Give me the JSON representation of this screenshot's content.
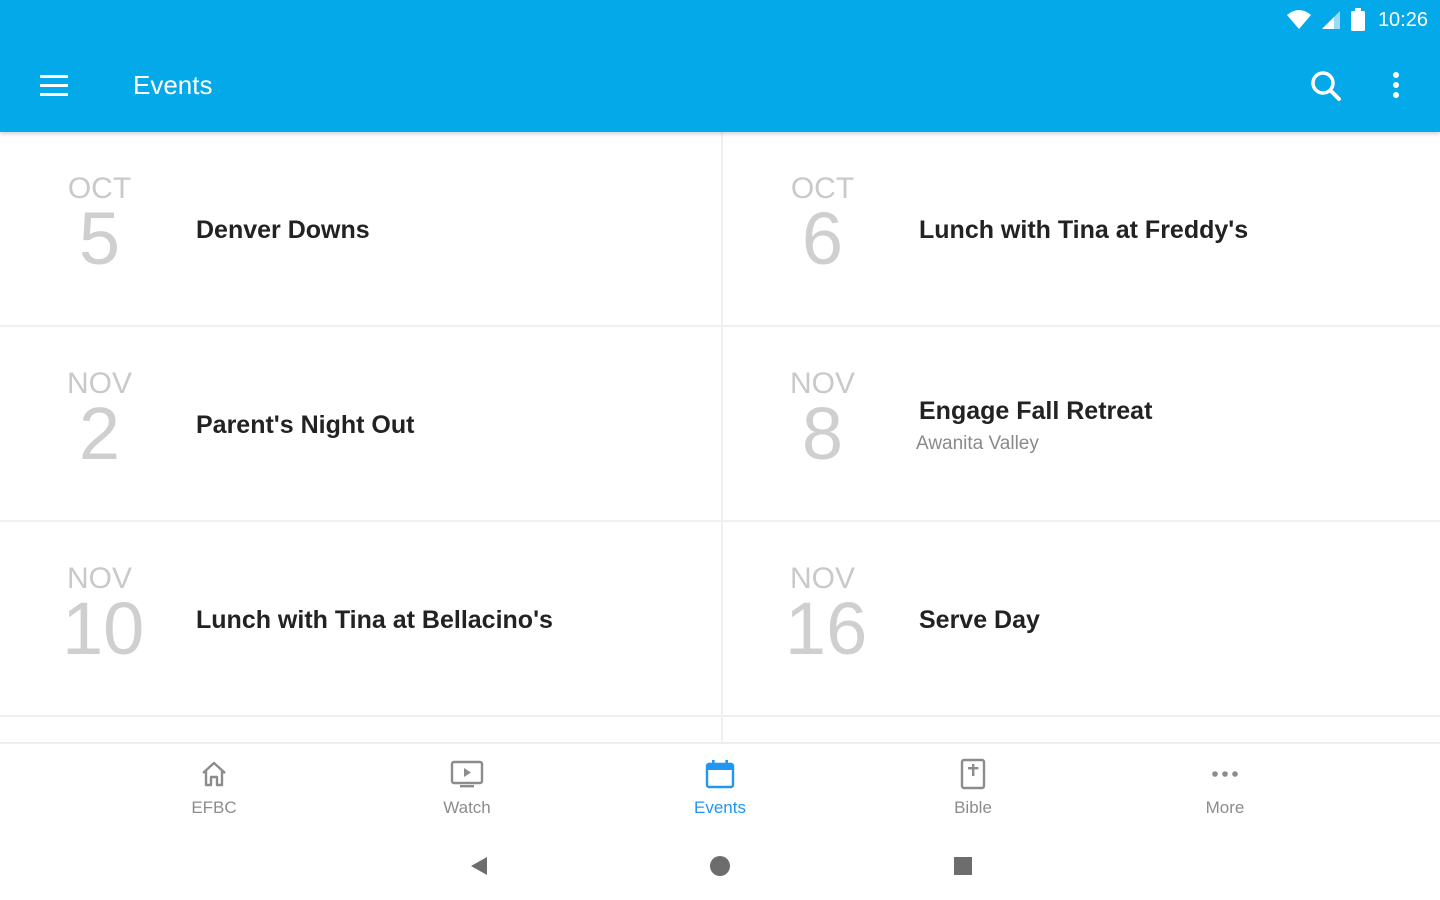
{
  "status_bar": {
    "time": "10:26"
  },
  "toolbar": {
    "title": "Events"
  },
  "events": [
    {
      "month": "OCT",
      "day": "5",
      "title": "Denver Downs",
      "subtitle": ""
    },
    {
      "month": "OCT",
      "day": "6",
      "title": "Lunch with Tina at Freddy's",
      "subtitle": ""
    },
    {
      "month": "NOV",
      "day": "2",
      "title": "Parent's Night Out",
      "subtitle": ""
    },
    {
      "month": "NOV",
      "day": "8",
      "title": "Engage Fall Retreat",
      "subtitle": "Awanita Valley"
    },
    {
      "month": "NOV",
      "day": "10",
      "title": "Lunch with Tina at Bellacino's",
      "subtitle": ""
    },
    {
      "month": "NOV",
      "day": "16",
      "title": "Serve Day",
      "subtitle": ""
    }
  ],
  "bottom_nav": [
    {
      "label": "EFBC",
      "icon": "home-icon",
      "active": false
    },
    {
      "label": "Watch",
      "icon": "tv-play-icon",
      "active": false
    },
    {
      "label": "Events",
      "icon": "calendar-icon",
      "active": true
    },
    {
      "label": "Bible",
      "icon": "bible-icon",
      "active": false
    },
    {
      "label": "More",
      "icon": "more-horiz-icon",
      "active": false
    }
  ],
  "colors": {
    "app_bar": "#03A9E8",
    "active_nav": "#2196F3",
    "inactive_nav": "#8c8c8c",
    "date_text": "#c9c9c9",
    "title_text": "#222222"
  }
}
